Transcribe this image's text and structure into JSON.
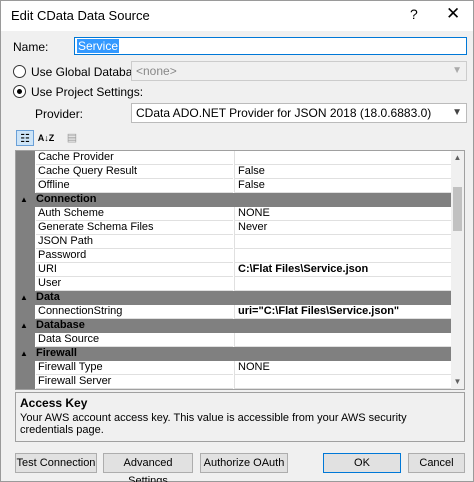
{
  "window": {
    "title": "Edit CData Data Source",
    "help": "?",
    "close": "✕"
  },
  "name": {
    "label": "Name:",
    "value": "Service"
  },
  "global_db": {
    "label": "Use Global Database:",
    "value": "<none>"
  },
  "project": {
    "label": "Use Project Settings:"
  },
  "provider": {
    "label": "Provider:",
    "value": "CData ADO.NET Provider for JSON 2018 (18.0.6883.0)"
  },
  "toolbar": {
    "categorized": "☷",
    "alphabetical": "A↓Z",
    "pages": "▤"
  },
  "grid": {
    "rows": [
      {
        "type": "prop",
        "name": "Cache Provider",
        "value": ""
      },
      {
        "type": "prop",
        "name": "Cache Query Result",
        "value": "False"
      },
      {
        "type": "prop",
        "name": "Offline",
        "value": "False"
      },
      {
        "type": "cat",
        "name": "Connection"
      },
      {
        "type": "prop",
        "name": "Auth Scheme",
        "value": "NONE"
      },
      {
        "type": "prop",
        "name": "Generate Schema Files",
        "value": "Never"
      },
      {
        "type": "prop",
        "name": "JSON Path",
        "value": ""
      },
      {
        "type": "prop",
        "name": "Password",
        "value": ""
      },
      {
        "type": "prop",
        "name": "URI",
        "value": "C:\\Flat Files\\Service.json",
        "bold": true
      },
      {
        "type": "prop",
        "name": "User",
        "value": ""
      },
      {
        "type": "cat",
        "name": "Data"
      },
      {
        "type": "prop",
        "name": "ConnectionString",
        "value": "uri=\"C:\\Flat Files\\Service.json\"",
        "bold": true
      },
      {
        "type": "cat",
        "name": "Database"
      },
      {
        "type": "prop",
        "name": "Data Source",
        "value": ""
      },
      {
        "type": "cat",
        "name": "Firewall"
      },
      {
        "type": "prop",
        "name": "Firewall Type",
        "value": "NONE"
      },
      {
        "type": "prop",
        "name": "Firewall Server",
        "value": ""
      },
      {
        "type": "prop",
        "name": "",
        "value": ""
      }
    ]
  },
  "description": {
    "title": "Access Key",
    "text": "Your AWS account access key. This value is accessible from your AWS security credentials page."
  },
  "buttons": {
    "test": "Test Connection",
    "advanced": "Advanced Settings",
    "oauth": "Authorize OAuth",
    "ok": "OK",
    "cancel": "Cancel"
  }
}
